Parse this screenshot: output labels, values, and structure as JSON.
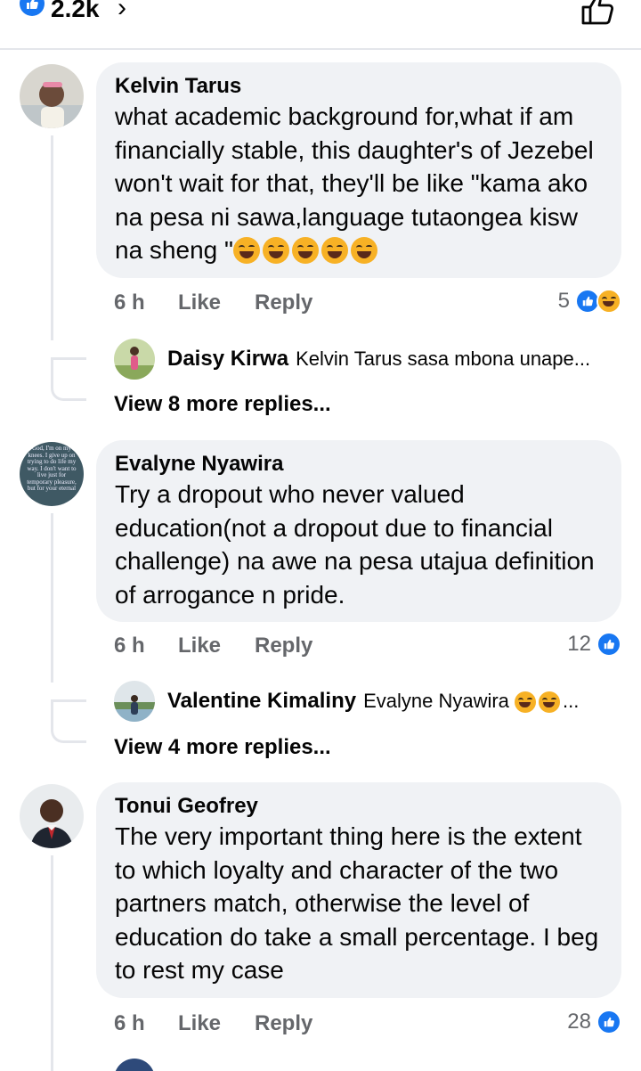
{
  "header": {
    "reaction_count": "2.2k",
    "chevron": "›",
    "like_icon": "thumbs-up-outline-icon"
  },
  "comments": [
    {
      "author": "Kelvin Tarus",
      "text": "what academic background for,what if am financially stable, this daughter's of Jezebel  won't wait for that, they'll be like \"kama ako na pesa ni sawa,language tutaongea kisw na sheng \"",
      "emoji_count": 5,
      "time": "6 h",
      "like_label": "Like",
      "reply_label": "Reply",
      "reaction_count": "5",
      "reply_preview": {
        "author": "Daisy Kirwa",
        "text": "Kelvin Tarus sasa mbona unape..."
      },
      "more_replies": "View 8 more replies..."
    },
    {
      "author": "Evalyne Nyawira",
      "avatar_text": "God, I'm on my knees. I give up on trying to do life my way. I don't want to live just for temporary pleasure, but for your eternal",
      "text": "Try a dropout who never valued education(not a dropout due to financial challenge) na awe na pesa utajua definition of arrogance n pride.",
      "time": "6 h",
      "like_label": "Like",
      "reply_label": "Reply",
      "reaction_count": "12",
      "reply_preview": {
        "author": "Valentine Kimaliny",
        "text": "Evalyne Nyawira",
        "trail": "..."
      },
      "more_replies": "View 4 more replies..."
    },
    {
      "author": "Tonui Geofrey",
      "text": "The very important thing here is the extent to which loyalty and character of the two partners match, otherwise the level of education do take a small percentage. I beg to rest my case",
      "time": "6 h",
      "like_label": "Like",
      "reply_label": "Reply",
      "reaction_count": "28"
    }
  ],
  "colors": {
    "accent": "#1877f2",
    "bubble": "#f0f2f5",
    "meta": "#65676b",
    "line": "#e4e6eb"
  }
}
